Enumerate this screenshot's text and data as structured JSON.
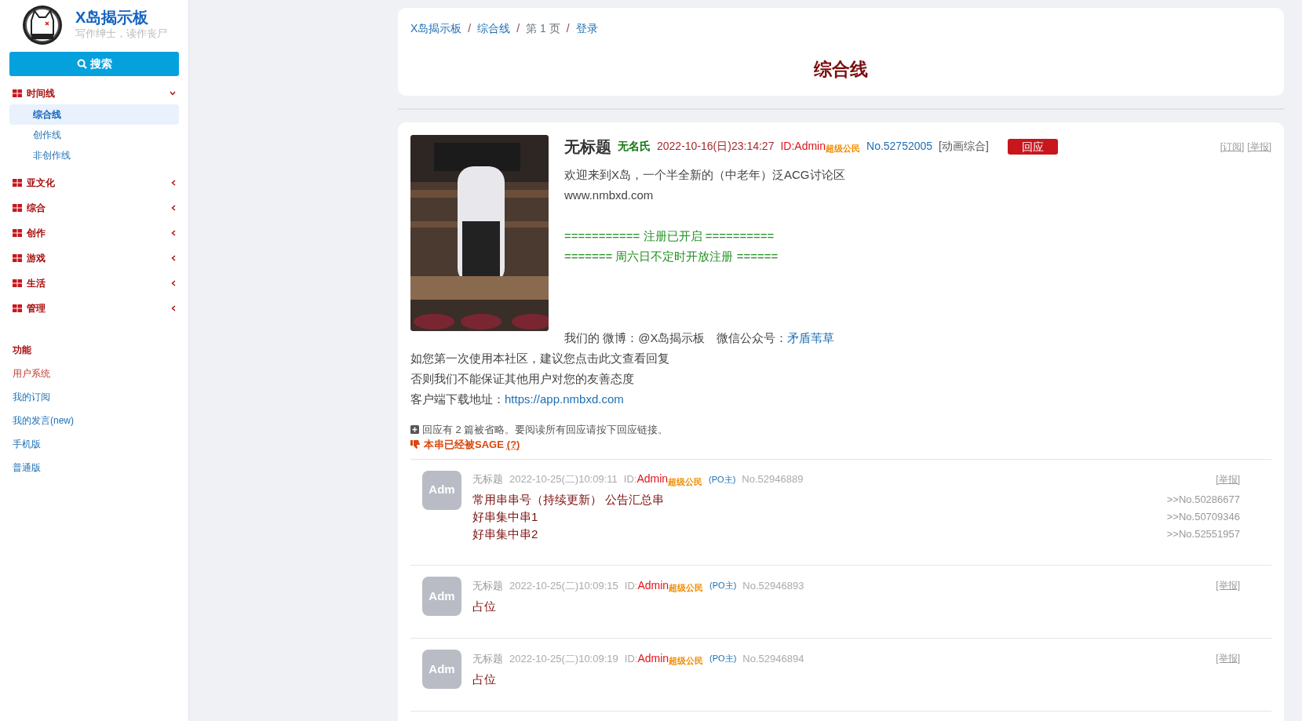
{
  "sidebar": {
    "site_title": "X岛揭示板",
    "slogan": "写作绅士，读作丧尸",
    "search_button": "搜索",
    "groups": [
      {
        "label": "时间线",
        "expanded": true,
        "children": [
          {
            "label": "综合线",
            "selected": true
          },
          {
            "label": "创作线",
            "selected": false
          },
          {
            "label": "非创作线",
            "selected": false
          }
        ]
      },
      {
        "label": "亚文化",
        "expanded": false
      },
      {
        "label": "综合",
        "expanded": false
      },
      {
        "label": "创作",
        "expanded": false
      },
      {
        "label": "游戏",
        "expanded": false
      },
      {
        "label": "生活",
        "expanded": false
      },
      {
        "label": "管理",
        "expanded": false
      }
    ],
    "functions_heading": "功能",
    "functions": [
      {
        "label": "用户系统",
        "selected": true
      },
      {
        "label": "我的订阅",
        "selected": false
      },
      {
        "label": "我的发言(new)",
        "selected": false
      },
      {
        "label": "手机版",
        "selected": false
      },
      {
        "label": "普通版",
        "selected": false
      }
    ]
  },
  "breadcrumb_separator": "/",
  "breadcrumb": [
    {
      "label": "X岛揭示板",
      "link": true
    },
    {
      "label": "综合线",
      "link": true
    },
    {
      "label": "第 1 页",
      "link": false
    },
    {
      "label": "登录",
      "link": true
    }
  ],
  "page_title": "综合线",
  "thread": {
    "title": "无标题",
    "name": "无名氏",
    "time": "2022-10-16(日)23:14:27",
    "id_prefix": "ID:",
    "id": "Admin",
    "badge": "超级公民",
    "no": "No.52752005",
    "board": "[动画综合]",
    "reply_button": "回应",
    "actions": [
      "[订阅]",
      "[举报]"
    ],
    "lines": [
      {
        "kind": "text",
        "text": "欢迎来到X岛，一个半全新的（中老年）泛ACG讨论区"
      },
      {
        "kind": "text",
        "text": "www.nmbxd.com"
      },
      {
        "kind": "spacer"
      },
      {
        "kind": "green",
        "text": "=========== 注册已开启 =========="
      },
      {
        "kind": "green",
        "text": "======= 周六日不定时开放注册 ======"
      },
      {
        "kind": "spacer"
      },
      {
        "kind": "spacer"
      },
      {
        "kind": "spacer"
      },
      {
        "kind": "text",
        "text": "我们的 微博：@X岛揭示板　微信公众号：",
        "link": "矛盾苇草"
      },
      {
        "kind": "text",
        "text": "如您第一次使用本社区，建议您点击此文查看回复"
      },
      {
        "kind": "text",
        "text": "否则我们不能保证其他用户对您的友善态度"
      },
      {
        "kind": "text",
        "text": "客户端下载地址：",
        "link": "https://app.nmbxd.com"
      }
    ],
    "omitted": "回应有 2 篇被省略。要阅读所有回应请按下回应链接。",
    "sage": "本串已经被SAGE",
    "sage_help": "(?)"
  },
  "replies": [
    {
      "avatar": "Adm",
      "title": "无标题",
      "time": "2022-10-25(二)10:09:11",
      "id_prefix": "ID:",
      "id": "Admin",
      "badge": "超级公民",
      "po": "(PO主)",
      "no": "No.52946889",
      "report": "[举报]",
      "lines": [
        "常用串串号（持续更新） 公告汇总串",
        "好串集中串1",
        "好串集中串2"
      ],
      "refs": [
        ">>No.50286677",
        ">>No.50709346",
        ">>No.52551957"
      ]
    },
    {
      "avatar": "Adm",
      "title": "无标题",
      "time": "2022-10-25(二)10:09:15",
      "id_prefix": "ID:",
      "id": "Admin",
      "badge": "超级公民",
      "po": "(PO主)",
      "no": "No.52946893",
      "report": "[举报]",
      "lines": [
        "占位"
      ]
    },
    {
      "avatar": "Adm",
      "title": "无标题",
      "time": "2022-10-25(二)10:09:19",
      "id_prefix": "ID:",
      "id": "Admin",
      "badge": "超级公民",
      "po": "(PO主)",
      "no": "No.52946894",
      "report": "[举报]",
      "lines": [
        "占位"
      ]
    }
  ]
}
